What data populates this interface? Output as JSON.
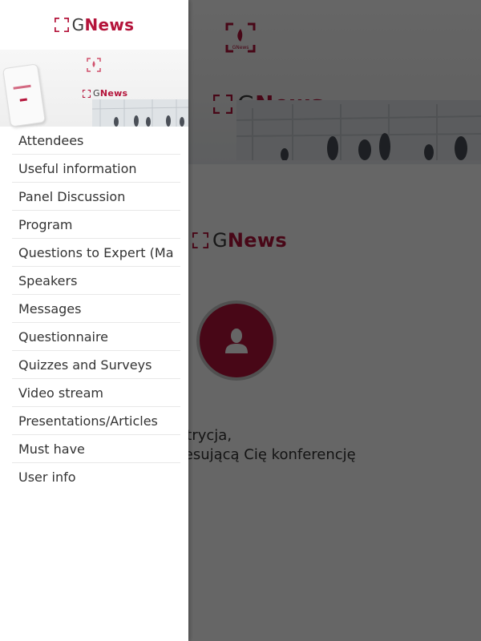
{
  "brand": {
    "logo_g": "G",
    "logo_news": "News",
    "accent_color": "#b4133a",
    "dark_text_color": "#3a3a3a"
  },
  "main": {
    "emblem_caption": "GNews",
    "greeting": "Witaj Patrycja,",
    "greeting_sub": "Wybierz interesującą Cię konferencję",
    "greeting_visible": "Witaj Patrycja,",
    "greeting_sub_visible": "ć interesującą Cię konferencję",
    "avatar_icon": "user-icon"
  },
  "drawer": {
    "menu_items": [
      {
        "label": "Attendees"
      },
      {
        "label": "Useful information"
      },
      {
        "label": "Panel Discussion"
      },
      {
        "label": "Program"
      },
      {
        "label": "Questions to Expert (Ma"
      },
      {
        "label": "Speakers"
      },
      {
        "label": "Messages"
      },
      {
        "label": "Questionnaire"
      },
      {
        "label": "Quizzes and Surveys"
      },
      {
        "label": "Video stream"
      },
      {
        "label": "Presentations/Articles"
      },
      {
        "label": "Must have"
      },
      {
        "label": "User info"
      }
    ]
  }
}
